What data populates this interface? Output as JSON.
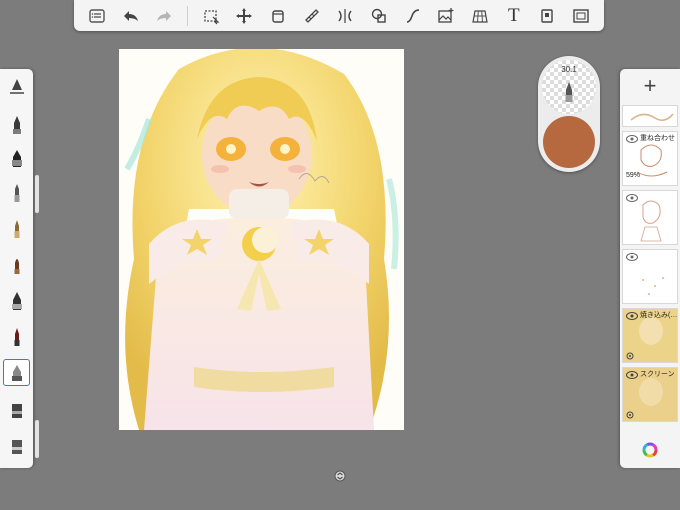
{
  "toolbar": {
    "buttons": [
      {
        "name": "layers-list-icon"
      },
      {
        "name": "undo-icon"
      },
      {
        "name": "redo-icon"
      },
      {
        "name": "selection-icon"
      },
      {
        "name": "transform-icon"
      },
      {
        "name": "fill-icon"
      },
      {
        "name": "ruler-icon"
      },
      {
        "name": "symmetry-icon"
      },
      {
        "name": "shapes-icon"
      },
      {
        "name": "curve-icon"
      },
      {
        "name": "add-image-icon"
      },
      {
        "name": "perspective-icon"
      },
      {
        "name": "text-icon",
        "label": "T"
      },
      {
        "name": "canvas-icon"
      },
      {
        "name": "fullscreen-icon"
      }
    ]
  },
  "brush_puck": {
    "size": "30.1",
    "opacity_checker": "transparent",
    "color": "#b6683f"
  },
  "layers": {
    "add_label": "+",
    "items": [
      {
        "name": "重ね合わせ",
        "opacity": "59%",
        "visible": true
      },
      {
        "name": "",
        "visible": true
      },
      {
        "name": "",
        "visible": true
      },
      {
        "name": "焼き込み(…",
        "visible": true
      },
      {
        "name": "スクリーン",
        "visible": true
      }
    ]
  },
  "colors": {
    "background": "#7c7c7c",
    "selected_brush_border": "#2e7de2",
    "current_color": "#b6683f"
  }
}
